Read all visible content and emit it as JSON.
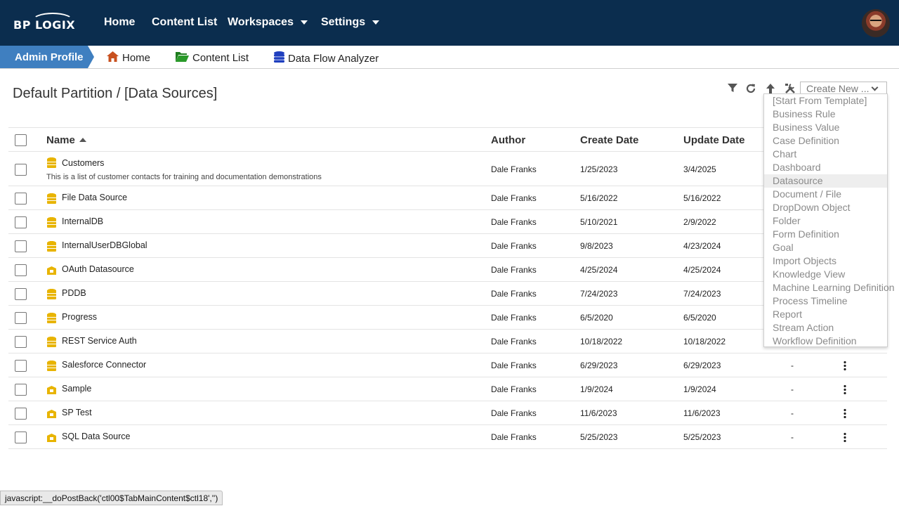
{
  "topnav": {
    "logo": "BP LOGIX",
    "items": [
      {
        "label": "Home",
        "has_caret": false
      },
      {
        "label": "Content List",
        "has_caret": false
      },
      {
        "label": "Workspaces",
        "has_caret": true
      },
      {
        "label": "Settings",
        "has_caret": true
      }
    ],
    "avatar_icon": "user-avatar"
  },
  "subnav": {
    "admin_label": "Admin Profile",
    "items": [
      {
        "label": "Home",
        "icon": "home-icon"
      },
      {
        "label": "Content List",
        "icon": "folder-open-icon"
      },
      {
        "label": "Data Flow Analyzer",
        "icon": "database-icon"
      }
    ]
  },
  "page": {
    "title": "Default Partition / [Data Sources]",
    "toolbar_icons": [
      "filter-icon",
      "refresh-icon",
      "upload-icon",
      "tools-icon"
    ],
    "create_new_label": "Create New ..."
  },
  "table": {
    "columns": {
      "name": "Name",
      "author": "Author",
      "create_date": "Create Date",
      "update_date": "Update Date"
    },
    "rows": [
      {
        "name": "Customers",
        "description": "This is a list of customer contacts for training and documentation demonstrations",
        "icon": "database-icon",
        "author": "Dale Franks",
        "create_date": "1/25/2023",
        "update_date": "3/4/2025",
        "extra": ""
      },
      {
        "name": "File Data Source",
        "description": "",
        "icon": "database-icon",
        "author": "Dale Franks",
        "create_date": "5/16/2022",
        "update_date": "5/16/2022",
        "extra": ""
      },
      {
        "name": "InternalDB",
        "description": "",
        "icon": "database-icon",
        "author": "Dale Franks",
        "create_date": "5/10/2021",
        "update_date": "2/9/2022",
        "extra": ""
      },
      {
        "name": "InternalUserDBGlobal",
        "description": "",
        "icon": "database-icon",
        "author": "Dale Franks",
        "create_date": "9/8/2023",
        "update_date": "4/23/2024",
        "extra": ""
      },
      {
        "name": "OAuth Datasource",
        "description": "",
        "icon": "folder-house-icon",
        "author": "Dale Franks",
        "create_date": "4/25/2024",
        "update_date": "4/25/2024",
        "extra": ""
      },
      {
        "name": "PDDB",
        "description": "",
        "icon": "database-icon",
        "author": "Dale Franks",
        "create_date": "7/24/2023",
        "update_date": "7/24/2023",
        "extra": ""
      },
      {
        "name": "Progress",
        "description": "",
        "icon": "database-icon",
        "author": "Dale Franks",
        "create_date": "6/5/2020",
        "update_date": "6/5/2020",
        "extra": ""
      },
      {
        "name": "REST Service Auth",
        "description": "",
        "icon": "database-icon",
        "author": "Dale Franks",
        "create_date": "10/18/2022",
        "update_date": "10/18/2022",
        "extra": ""
      },
      {
        "name": "Salesforce Connector",
        "description": "",
        "icon": "database-icon",
        "author": "Dale Franks",
        "create_date": "6/29/2023",
        "update_date": "6/29/2023",
        "extra": "-"
      },
      {
        "name": "Sample",
        "description": "",
        "icon": "folder-house-icon",
        "author": "Dale Franks",
        "create_date": "1/9/2024",
        "update_date": "1/9/2024",
        "extra": "-"
      },
      {
        "name": "SP Test",
        "description": "",
        "icon": "folder-house-icon",
        "author": "Dale Franks",
        "create_date": "11/6/2023",
        "update_date": "11/6/2023",
        "extra": "-"
      },
      {
        "name": "SQL Data Source",
        "description": "",
        "icon": "folder-house-icon",
        "author": "Dale Franks",
        "create_date": "5/25/2023",
        "update_date": "5/25/2023",
        "extra": "-"
      }
    ]
  },
  "create_menu": {
    "selected": "Datasource",
    "items": [
      "[Start From Template]",
      "Business Rule",
      "Business Value",
      "Case Definition",
      "Chart",
      "Dashboard",
      "Datasource",
      "Document / File",
      "DropDown Object",
      "Folder",
      "Form Definition",
      "Goal",
      "Import Objects",
      "Knowledge View",
      "Machine Learning Definition",
      "Process Timeline",
      "Report",
      "Stream Action",
      "Workflow Definition"
    ]
  },
  "status_bar": "javascript:__doPostBack('ctl00$TabMainContent$ctl18','')",
  "colors": {
    "topbar": "#0b2d4e",
    "admin_tab": "#3f7fc0",
    "icon_yellow": "#e8b400",
    "home_icon": "#c8501e",
    "folder_icon": "#2a9a2a",
    "db_icon": "#1f3fbf"
  }
}
